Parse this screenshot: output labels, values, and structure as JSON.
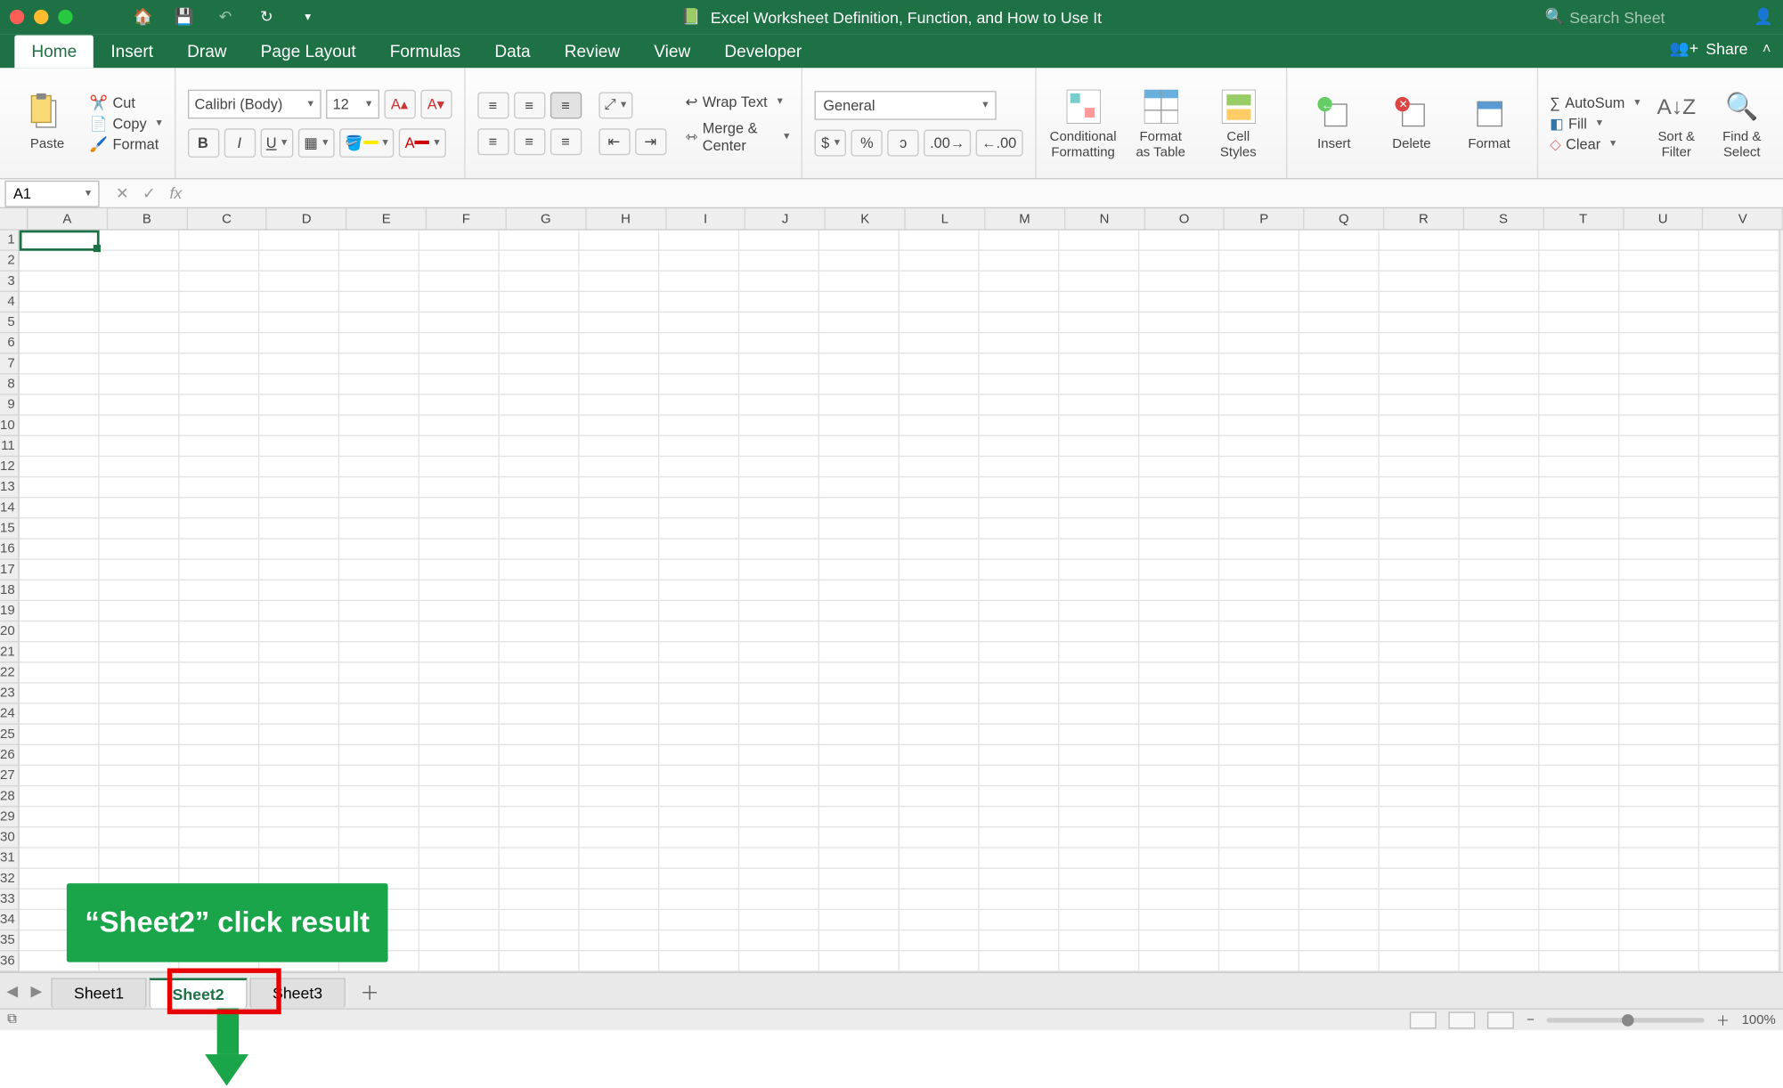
{
  "title": "Excel Worksheet Definition, Function, and How to Use It",
  "search_placeholder": "Search Sheet",
  "share_label": "Share",
  "tabs": [
    "Home",
    "Insert",
    "Draw",
    "Page Layout",
    "Formulas",
    "Data",
    "Review",
    "View",
    "Developer"
  ],
  "active_tab": "Home",
  "clipboard": {
    "paste": "Paste",
    "cut": "Cut",
    "copy": "Copy",
    "format": "Format"
  },
  "font": {
    "name": "Calibri (Body)",
    "size": "12"
  },
  "alignment": {
    "wrap": "Wrap Text",
    "merge": "Merge & Center"
  },
  "number_format": "General",
  "styles": {
    "cond": "Conditional\nFormatting",
    "table": "Format\nas Table",
    "cell": "Cell\nStyles"
  },
  "cells": {
    "insert": "Insert",
    "delete": "Delete",
    "format": "Format"
  },
  "editing": {
    "autosum": "AutoSum",
    "fill": "Fill",
    "clear": "Clear",
    "sort": "Sort &\nFilter",
    "find": "Find &\nSelect"
  },
  "name_box": "A1",
  "columns": [
    "A",
    "B",
    "C",
    "D",
    "E",
    "F",
    "G",
    "H",
    "I",
    "J",
    "K",
    "L",
    "M",
    "N",
    "O",
    "P",
    "Q",
    "R",
    "S",
    "T",
    "U",
    "V"
  ],
  "row_count": 36,
  "annotation": "“Sheet2” click result",
  "sheets": [
    "Sheet1",
    "Sheet2",
    "Sheet3"
  ],
  "active_sheet": "Sheet2",
  "zoom": "100%"
}
